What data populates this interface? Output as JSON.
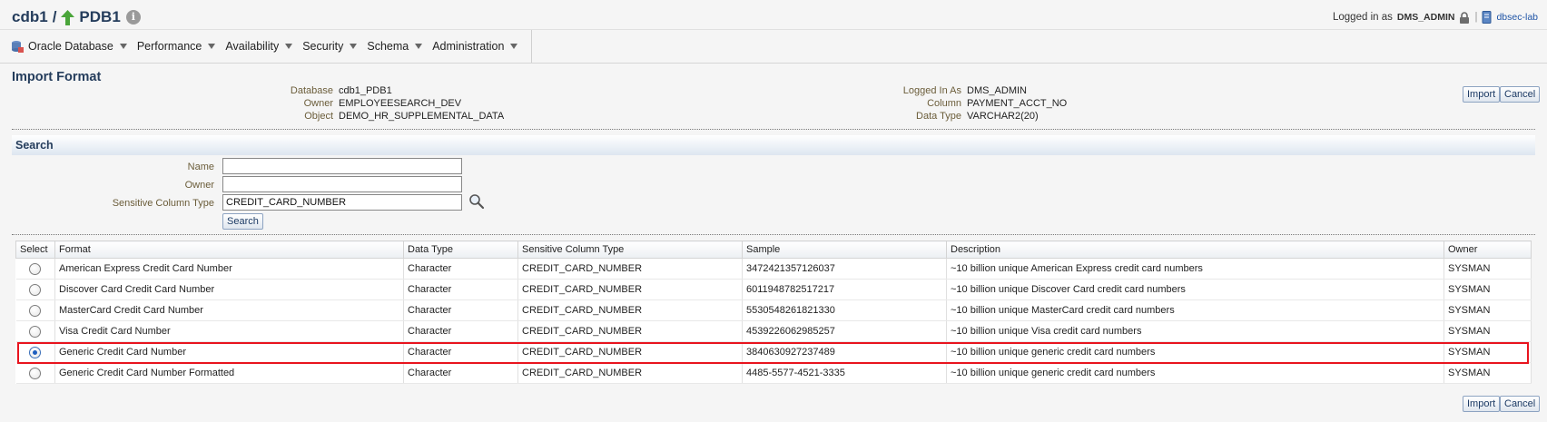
{
  "header": {
    "container": "cdb1",
    "separator": "/",
    "pdb": "PDB1",
    "logged_in_label": "Logged in as",
    "username": "DMS_ADMIN",
    "divider": "|",
    "host": "dbsec-lab"
  },
  "menu": [
    {
      "label": "Oracle Database"
    },
    {
      "label": "Performance"
    },
    {
      "label": "Availability"
    },
    {
      "label": "Security"
    },
    {
      "label": "Schema"
    },
    {
      "label": "Administration"
    }
  ],
  "page_title": "Import Format",
  "info_left": [
    {
      "key": "Database",
      "value": "cdb1_PDB1"
    },
    {
      "key": "Owner",
      "value": "EMPLOYEESEARCH_DEV"
    },
    {
      "key": "Object",
      "value": "DEMO_HR_SUPPLEMENTAL_DATA"
    }
  ],
  "info_right": [
    {
      "key": "Logged In As",
      "value": "DMS_ADMIN"
    },
    {
      "key": "Column",
      "value": "PAYMENT_ACCT_NO"
    },
    {
      "key": "Data Type",
      "value": "VARCHAR2(20)"
    }
  ],
  "buttons": {
    "import": "Import",
    "cancel": "Cancel",
    "search": "Search"
  },
  "search": {
    "title": "Search",
    "fields": [
      {
        "label": "Name",
        "value": ""
      },
      {
        "label": "Owner",
        "value": ""
      },
      {
        "label": "Sensitive Column Type",
        "value": "CREDIT_CARD_NUMBER"
      }
    ]
  },
  "table": {
    "columns": [
      "Select",
      "Format",
      "Data Type",
      "Sensitive Column Type",
      "Sample",
      "Description",
      "Owner"
    ],
    "selected_index": 4,
    "rows": [
      {
        "format": "American Express Credit Card Number",
        "data_type": "Character",
        "sensitive_type": "CREDIT_CARD_NUMBER",
        "sample": "3472421357126037",
        "description": "~10 billion unique American Express credit card numbers",
        "owner": "SYSMAN"
      },
      {
        "format": "Discover Card Credit Card Number",
        "data_type": "Character",
        "sensitive_type": "CREDIT_CARD_NUMBER",
        "sample": "6011948782517217",
        "description": "~10 billion unique Discover Card credit card numbers",
        "owner": "SYSMAN"
      },
      {
        "format": "MasterCard Credit Card Number",
        "data_type": "Character",
        "sensitive_type": "CREDIT_CARD_NUMBER",
        "sample": "5530548261821330",
        "description": "~10 billion unique MasterCard credit card numbers",
        "owner": "SYSMAN"
      },
      {
        "format": "Visa Credit Card Number",
        "data_type": "Character",
        "sensitive_type": "CREDIT_CARD_NUMBER",
        "sample": "4539226062985257",
        "description": "~10 billion unique Visa credit card numbers",
        "owner": "SYSMAN"
      },
      {
        "format": "Generic Credit Card Number",
        "data_type": "Character",
        "sensitive_type": "CREDIT_CARD_NUMBER",
        "sample": "3840630927237489",
        "description": "~10 billion unique generic credit card numbers",
        "owner": "SYSMAN"
      },
      {
        "format": "Generic Credit Card Number Formatted",
        "data_type": "Character",
        "sensitive_type": "CREDIT_CARD_NUMBER",
        "sample": "4485-5577-4521-3335",
        "description": "~10 billion unique generic credit card numbers",
        "owner": "SYSMAN"
      }
    ]
  },
  "colors": {
    "title": "#253d5c",
    "label": "#6b5d3a",
    "highlight": "#e8141e",
    "link": "#1f54a6"
  },
  "icons": [
    "up-arrow-icon",
    "info-icon",
    "lock-icon",
    "server-icon",
    "database-icon",
    "chevron-down-icon",
    "search-icon"
  ]
}
